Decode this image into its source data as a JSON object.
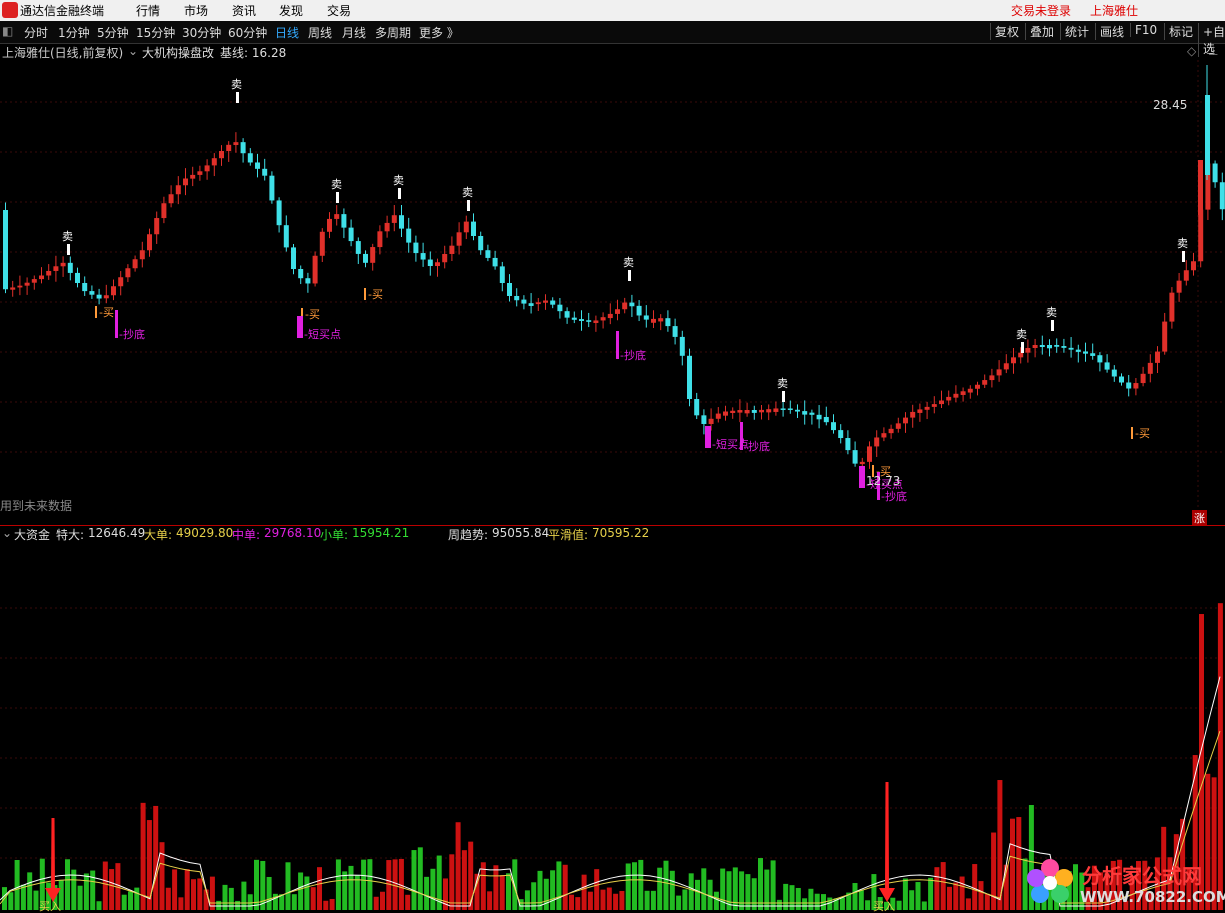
{
  "menubar": {
    "app_title": "通达信金融终端",
    "items": [
      "行情",
      "市场",
      "资讯",
      "发现",
      "交易"
    ],
    "right_login": "交易未登录",
    "right_stock": "上海雅仕"
  },
  "toolbar": {
    "periods": [
      "分时",
      "1分钟",
      "5分钟",
      "15分钟",
      "30分钟",
      "60分钟",
      "日线",
      "周线",
      "月线",
      "多周期",
      "更多 》"
    ],
    "active": "日线",
    "right_buttons": [
      "复权",
      "叠加",
      "统计",
      "画线",
      "F10",
      "标记",
      "+自选"
    ]
  },
  "main_panel": {
    "stock_info": "上海雅仕(日线,前复权)",
    "indicator_name": "大机构操盘改",
    "baseline_label": "基线: 16.28",
    "future_note": "用到未来数据",
    "high_price_label": "28.45",
    "low_price_label": "12.73",
    "zhang_badge": "涨"
  },
  "signals": {
    "sell": "卖",
    "buy": "买",
    "bottom": "抄底",
    "short_buy": "短买点"
  },
  "indicator_panel": {
    "name": "大资金",
    "tedai_label": "特大:",
    "tedai_value": "12646.49",
    "dadan_label": "大单:",
    "dadan_value": "49029.80",
    "zhongdan_label": "中单:",
    "zhongdan_value": "29768.10",
    "xiaodan_label": "小单:",
    "xiaodan_value": "15954.21",
    "weekly_label": "周趋势:",
    "weekly_value": "95055.84",
    "smooth_label": "平滑值:",
    "smooth_value": "70595.22",
    "buy_in_label": "买入"
  },
  "watermark": {
    "brand": "分析家公式网",
    "url": "WWW.70822.COM"
  },
  "colors": {
    "up": "#e0302a",
    "down": "#3fe0e8",
    "bar_up": "#cc1111",
    "bar_down": "#22bb22",
    "magenta": "#e020e0",
    "orange": "#ff9a3a",
    "yellow": "#e6d04a"
  }
}
